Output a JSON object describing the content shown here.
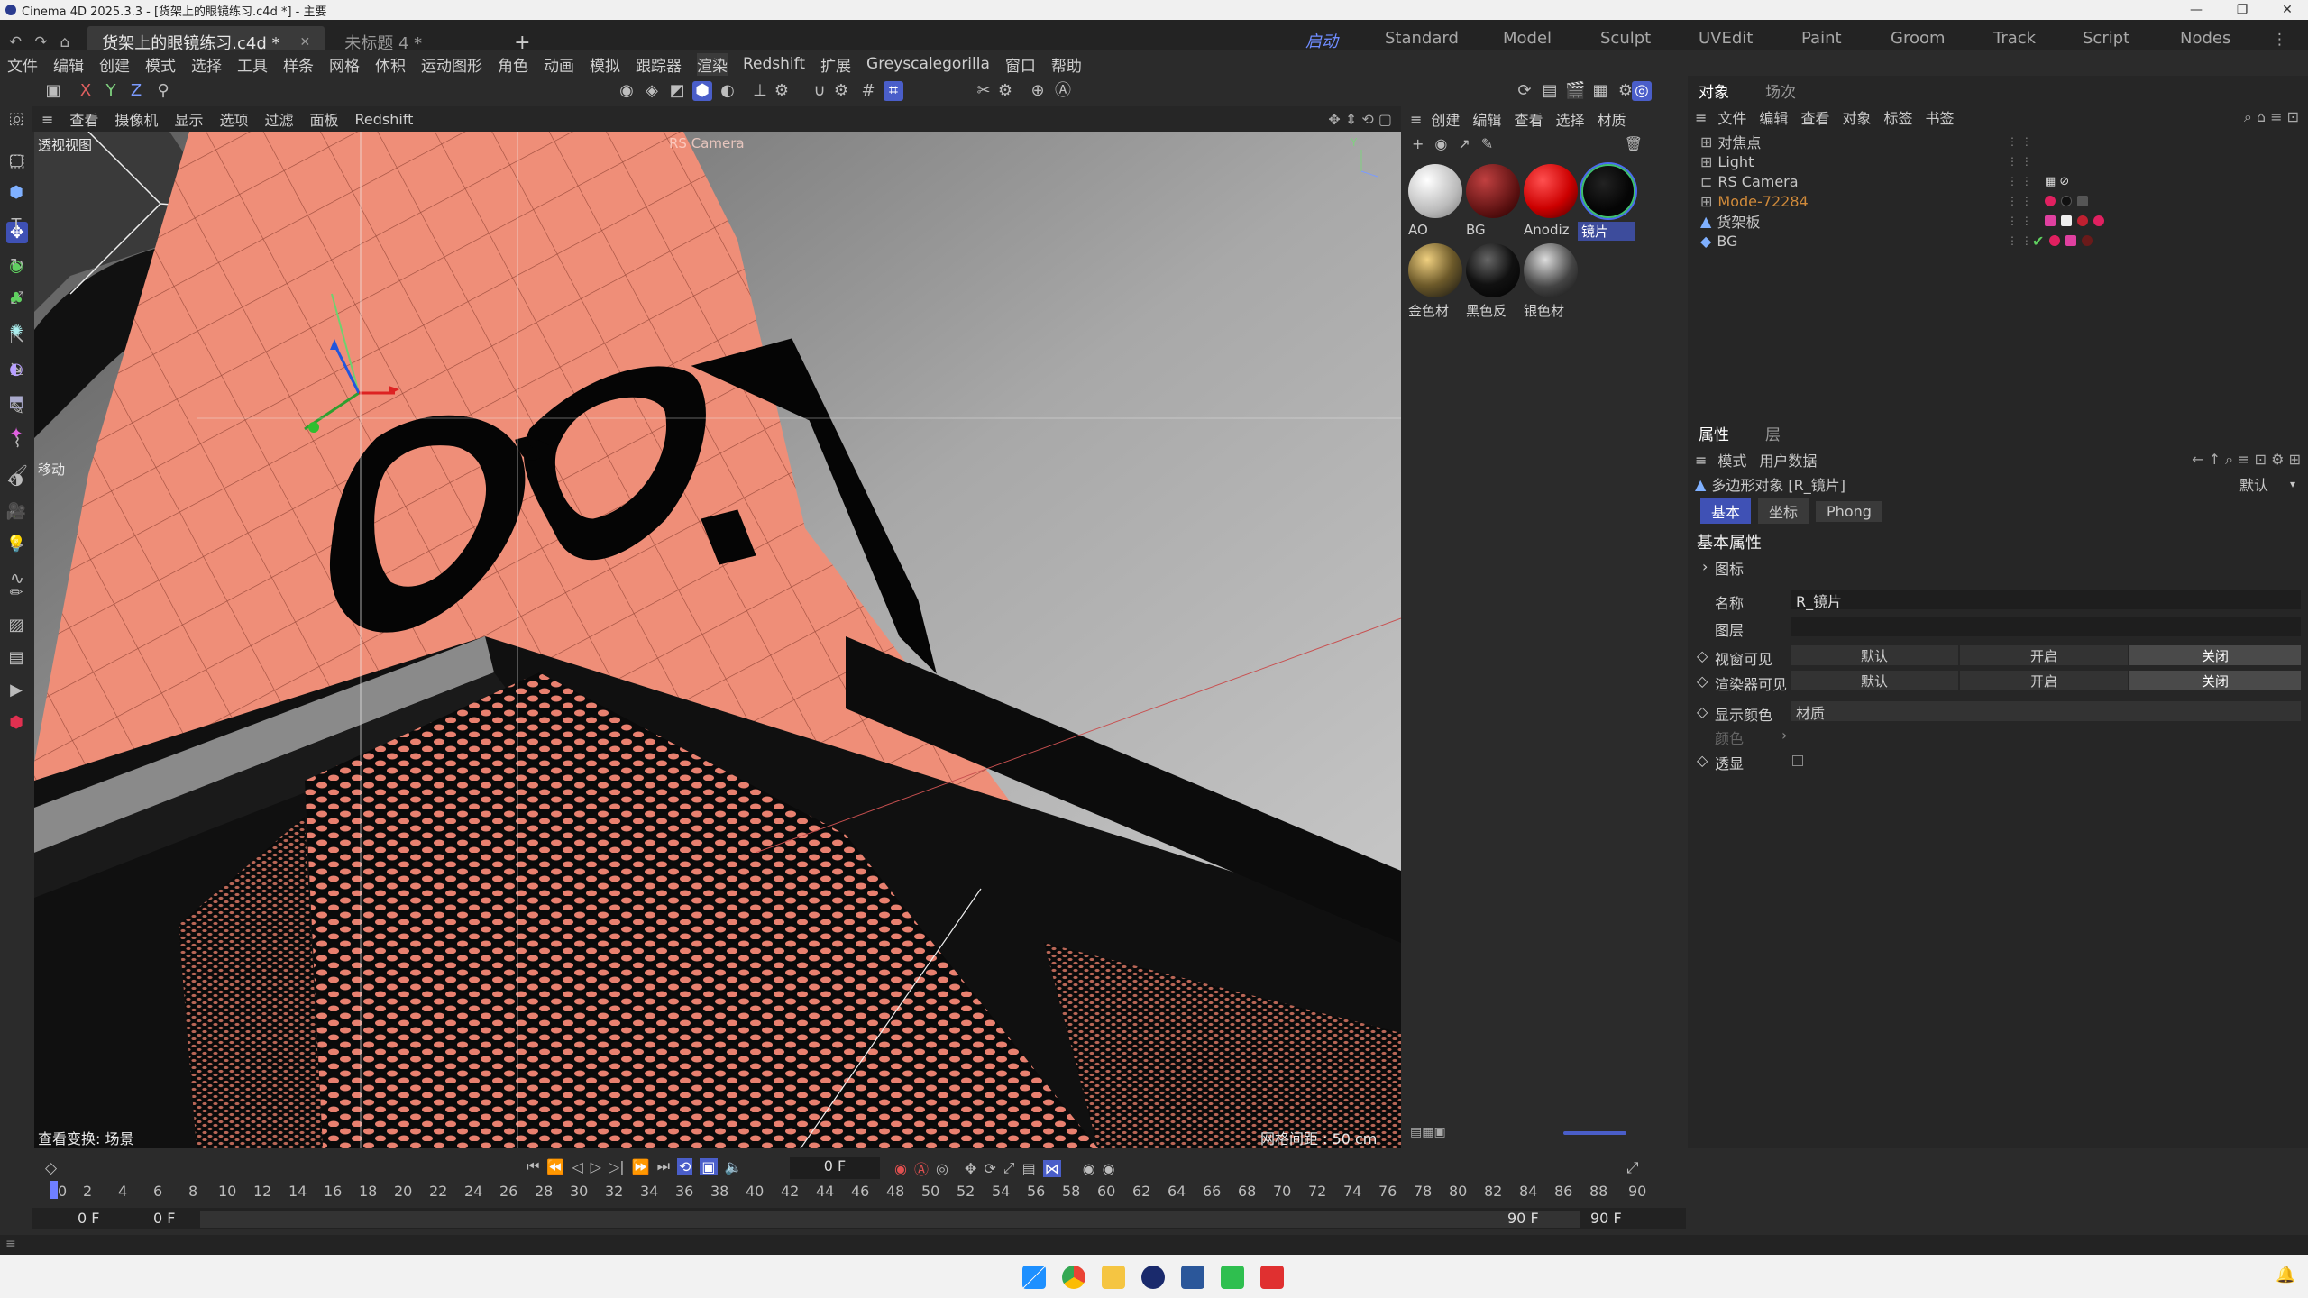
{
  "window": {
    "title": "Cinema 4D 2025.3.3 - [货架上的眼镜练习.c4d *] - 主要"
  },
  "doc_tabs": [
    {
      "label": "货架上的眼镜练习.c4d *",
      "active": true
    },
    {
      "label": "未标题 4 *",
      "active": false
    }
  ],
  "layout_tabs": [
    "启动",
    "Standard",
    "Model",
    "Sculpt",
    "UVEdit",
    "Paint",
    "Groom",
    "Track",
    "Script",
    "Nodes"
  ],
  "menu": [
    "文件",
    "编辑",
    "创建",
    "模式",
    "选择",
    "工具",
    "样条",
    "网格",
    "体积",
    "运动图形",
    "角色",
    "动画",
    "模拟",
    "跟踪器",
    "渲染",
    "Redshift",
    "扩展",
    "Greyscalegorilla",
    "窗口",
    "帮助"
  ],
  "axes": [
    "X",
    "Y",
    "Z"
  ],
  "viewport": {
    "menu": [
      "查看",
      "摄像机",
      "显示",
      "选项",
      "过滤",
      "面板",
      "Redshift"
    ],
    "label": "透视视图",
    "camera_label": "RS Camera",
    "move_label": "移动",
    "status_left": "查看变换: 场景",
    "grid_spacing": "网格间距 : 50 cm"
  },
  "materials": {
    "menu": [
      "创建",
      "编辑",
      "查看",
      "选择",
      "材质"
    ],
    "items": [
      {
        "label": "AO",
        "color": "#e0e0e0"
      },
      {
        "label": "BG",
        "color": "#8a1f1f"
      },
      {
        "label": "Anodiz",
        "color": "#cc1010"
      },
      {
        "label": "镜片",
        "color": "#0d0d0d"
      },
      {
        "label": "金色材",
        "color": "#6d5a2a"
      },
      {
        "label": "黑色反",
        "color": "#111111"
      },
      {
        "label": "银色材",
        "color": "#4a4a4a"
      }
    ]
  },
  "object_manager": {
    "tabs": [
      "对象",
      "场次"
    ],
    "menu": [
      "文件",
      "编辑",
      "查看",
      "对象",
      "标签",
      "书签"
    ],
    "objects": [
      {
        "name": "对焦点",
        "color": "#cfcfcf"
      },
      {
        "name": "Light",
        "color": "#cfcfcf"
      },
      {
        "name": "RS Camera",
        "color": "#cfcfcf"
      },
      {
        "name": "Mode-72284",
        "color": "#d08a3a"
      },
      {
        "name": "货架板",
        "color": "#cfcfcf"
      },
      {
        "name": "BG",
        "color": "#cfcfcf"
      }
    ]
  },
  "attributes": {
    "tabs": [
      "属性",
      "层"
    ],
    "menu": [
      "模式",
      "用户数据"
    ],
    "object_title": "多边形对象 [R_镜片]",
    "preset": "默认",
    "sub_tabs": [
      "基本",
      "坐标",
      "Phong"
    ],
    "section": "基本属性",
    "group": "图标",
    "name_label": "名称",
    "name_value": "R_镜片",
    "layer_label": "图层",
    "view_visible_label": "视窗可见",
    "render_visible_label": "渲染器可见",
    "vis_options": [
      "默认",
      "开启",
      "关闭"
    ],
    "display_color_label": "显示颜色",
    "display_color_value": "材质",
    "color_label": "颜色",
    "xray_label": "透显"
  },
  "timeline": {
    "current_frame": "0 F",
    "ticks": [
      "0",
      "2",
      "4",
      "6",
      "8",
      "10",
      "12",
      "14",
      "16",
      "18",
      "20",
      "22",
      "24",
      "26",
      "28",
      "30",
      "32",
      "34",
      "36",
      "38",
      "40",
      "42",
      "44",
      "46",
      "48",
      "50",
      "52",
      "54",
      "56",
      "58",
      "60",
      "62",
      "64",
      "66",
      "68",
      "70",
      "72",
      "74",
      "76",
      "78",
      "80",
      "82",
      "84",
      "86",
      "88",
      "90"
    ],
    "start": "0 F",
    "range_start": "0 F",
    "range_end": "90 F",
    "end": "90 F"
  }
}
